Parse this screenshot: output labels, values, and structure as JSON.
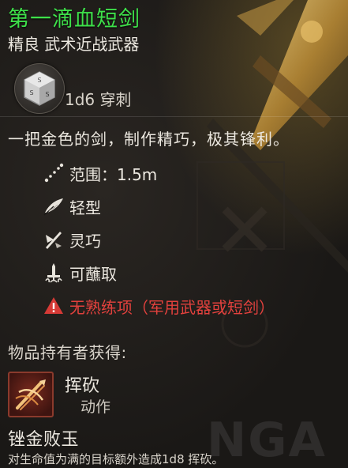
{
  "item": {
    "name": "第一滴血短剑",
    "subtitle": "精良 武术近战武器",
    "damage": "1d6 穿刺",
    "description": "一把金色的剑，制作精巧，极其锋利。"
  },
  "properties": [
    {
      "icon": "range-icon",
      "label": "范围：1.5m"
    },
    {
      "icon": "feather-icon",
      "label": "轻型"
    },
    {
      "icon": "finesse-icon",
      "label": "灵巧"
    },
    {
      "icon": "dippable-icon",
      "label": "可蘸取"
    },
    {
      "icon": "warning-icon",
      "label": "无熟练项（军用武器或短剑）"
    }
  ],
  "grants": {
    "heading": "物品持有者获得:",
    "action_name": "挥砍",
    "action_type": "动作"
  },
  "feature": {
    "name": "锉金败玉",
    "description": "对生命值为满的目标额外造成1d8 挥砍。"
  },
  "colors": {
    "rarity_green": "#3ee04a",
    "warning_red": "#e2413d"
  }
}
